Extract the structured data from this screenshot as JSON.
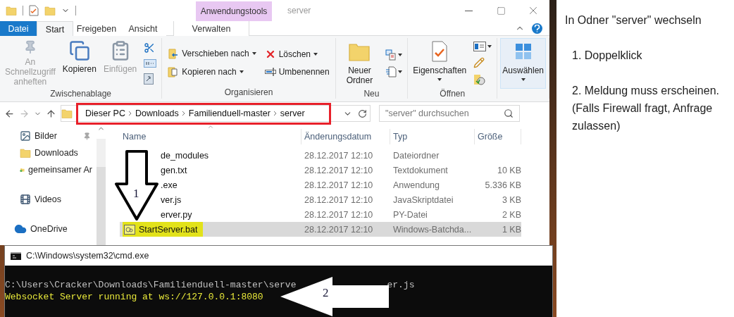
{
  "explorer": {
    "context_tab": "Anwendungstools",
    "title": "server",
    "tabs": [
      {
        "label": "Datei",
        "kind": "file",
        "selected": false
      },
      {
        "label": "Start",
        "kind": "tab",
        "selected": true
      },
      {
        "label": "Freigeben",
        "kind": "tab",
        "selected": false
      },
      {
        "label": "Ansicht",
        "kind": "tab",
        "selected": false
      },
      {
        "label": "Verwalten",
        "kind": "context",
        "selected": false
      }
    ],
    "ribbon": [
      {
        "label": "Zwischenablage",
        "items": [
          {
            "kind": "large",
            "label": "An Schnellzugriff anheften",
            "disabled": true,
            "dropdown": false,
            "highlighted": false
          },
          {
            "kind": "large",
            "label": "Kopieren",
            "disabled": false,
            "dropdown": false,
            "highlighted": false
          },
          {
            "kind": "large",
            "label": "Einfügen",
            "disabled": true,
            "dropdown": false,
            "highlighted": false
          },
          {
            "kind": "stack",
            "items": [
              {
                "kind": "icon",
                "dropdown": false
              },
              {
                "kind": "icon",
                "dropdown": false
              },
              {
                "kind": "icon",
                "dropdown": false
              }
            ]
          }
        ]
      },
      {
        "label": "Organisieren",
        "items": [
          {
            "kind": "stack",
            "items": [
              {
                "kind": "small",
                "label": "Verschieben nach",
                "dropdown": true
              },
              {
                "kind": "small",
                "label": "Kopieren nach",
                "dropdown": true
              }
            ]
          },
          {
            "kind": "stack",
            "items": [
              {
                "kind": "small",
                "label": "Löschen",
                "dropdown": true
              },
              {
                "kind": "small",
                "label": "Umbenennen",
                "dropdown": false
              }
            ]
          }
        ]
      },
      {
        "label": "Neu",
        "items": [
          {
            "kind": "large",
            "label": "Neuer Ordner",
            "disabled": false,
            "dropdown": false,
            "highlighted": false
          },
          {
            "kind": "stack",
            "items": [
              {
                "kind": "icon",
                "dropdown": true
              },
              {
                "kind": "icon",
                "dropdown": true
              }
            ]
          }
        ]
      },
      {
        "label": "Öffnen",
        "items": [
          {
            "kind": "large",
            "label": "Eigenschaften",
            "disabled": false,
            "dropdown": true,
            "highlighted": false
          },
          {
            "kind": "stack",
            "items": [
              {
                "kind": "icon",
                "dropdown": true
              },
              {
                "kind": "icon",
                "dropdown": false
              },
              {
                "kind": "icon",
                "dropdown": false
              }
            ]
          }
        ]
      },
      {
        "items": [
          {
            "kind": "large",
            "label": "Auswählen",
            "disabled": false,
            "dropdown": true,
            "highlighted": true
          }
        ]
      }
    ],
    "address": {
      "highlighted": true,
      "path": [
        "Dieser PC",
        "Downloads",
        "Familienduell-master",
        "server"
      ]
    },
    "search": {
      "placeholder": "\"server\" durchsuchen"
    },
    "sidebar": [
      {
        "label": "Bilder",
        "kind": "pictures",
        "pinned": true,
        "group_start": false
      },
      {
        "label": "Downloads",
        "kind": "folder",
        "pinned": false,
        "group_start": false
      },
      {
        "label": "gemeinsamer Ar",
        "kind": "shared",
        "pinned": false,
        "group_start": false
      },
      {
        "label": "Videos",
        "kind": "videos",
        "pinned": false,
        "group_start": true
      },
      {
        "label": "OneDrive",
        "kind": "cloud",
        "pinned": false,
        "group_start": true
      }
    ],
    "columns": [
      "Name",
      "Änderungsdatum",
      "Typ",
      "Größe"
    ],
    "rows": [
      {
        "name": "de_modules",
        "kind": "covered",
        "date": "28.12.2017 12:10",
        "type": "Dateiordner",
        "size": "",
        "selected": false,
        "marked": false
      },
      {
        "name": "gen.txt",
        "kind": "covered",
        "date": "28.12.2017 12:10",
        "type": "Textdokument",
        "size": "10 KB",
        "selected": false,
        "marked": false
      },
      {
        "name": ".exe",
        "kind": "covered",
        "date": "28.12.2017 12:10",
        "type": "Anwendung",
        "size": "5.336 KB",
        "selected": false,
        "marked": false
      },
      {
        "name": "ver.js",
        "kind": "covered",
        "date": "28.12.2017 12:10",
        "type": "JavaSkriptdatei",
        "size": "3 KB",
        "selected": false,
        "marked": false
      },
      {
        "name": "erver.py",
        "kind": "covered",
        "date": "28.12.2017 12:10",
        "type": "PY-Datei",
        "size": "2 KB",
        "selected": false,
        "marked": false
      },
      {
        "name": "StartServer.bat",
        "kind": "batch",
        "date": "28.12.2017 12:10",
        "type": "Windows-Batchda...",
        "size": "1 KB",
        "selected": true,
        "marked": true
      }
    ]
  },
  "console": {
    "title": "C:\\Windows\\system32\\cmd.exe",
    "lines": [
      {
        "kind": "output",
        "parts": [
          "C:\\Users\\Cracker\\Downloads\\Familienduell-master\\serve",
          "er.js"
        ]
      },
      {
        "kind": "status",
        "parts": [
          "Websocket Server running at ws://127.0.0.1:8080"
        ]
      }
    ]
  },
  "annotations": [
    {
      "kind": "down-arrow",
      "label": "1"
    },
    {
      "kind": "left-arrow",
      "label": "2"
    }
  ],
  "notes": [
    {
      "text": "In Odner \"server\" wechseln",
      "indent": false
    },
    {
      "text": "1. Doppelklick",
      "indent": true
    },
    {
      "text": "2. Meldung muss erscheinen. (Falls Firewall fragt, Anfrage zulassen)",
      "indent": true
    }
  ]
}
